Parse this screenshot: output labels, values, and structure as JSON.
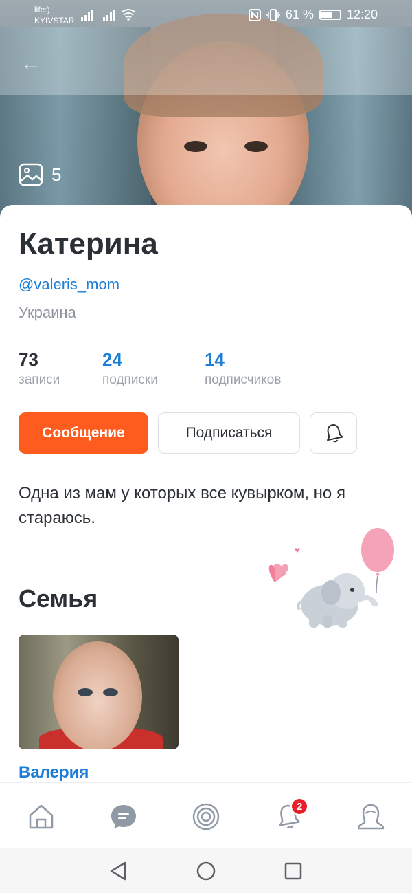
{
  "status_bar": {
    "carrier_line1": "life:)",
    "carrier_line2": "KYIVSTAR",
    "battery": "61 %",
    "time": "12:20"
  },
  "cover": {
    "photo_count": "5"
  },
  "profile": {
    "name": "Катерина",
    "handle": "@valeris_mom",
    "country": "Украина",
    "stats": [
      {
        "value": "73",
        "label": "записи"
      },
      {
        "value": "24",
        "label": "подписки"
      },
      {
        "value": "14",
        "label": "подписчиков"
      }
    ],
    "actions": {
      "message_label": "Сообщение",
      "subscribe_label": "Подписаться"
    },
    "bio": "Одна из мам у которых все кувырком, но я стараюсь."
  },
  "family": {
    "title": "Семья",
    "members": [
      {
        "name": "Валерия"
      }
    ]
  },
  "bottom_nav": {
    "items": [
      "home-icon",
      "chat-icon",
      "target-icon",
      "bell-icon",
      "profile-icon"
    ],
    "notification_badge": "2"
  },
  "colors": {
    "accent": "#fe5b1f",
    "link": "#1c7ed6",
    "badge": "#e8202a"
  }
}
